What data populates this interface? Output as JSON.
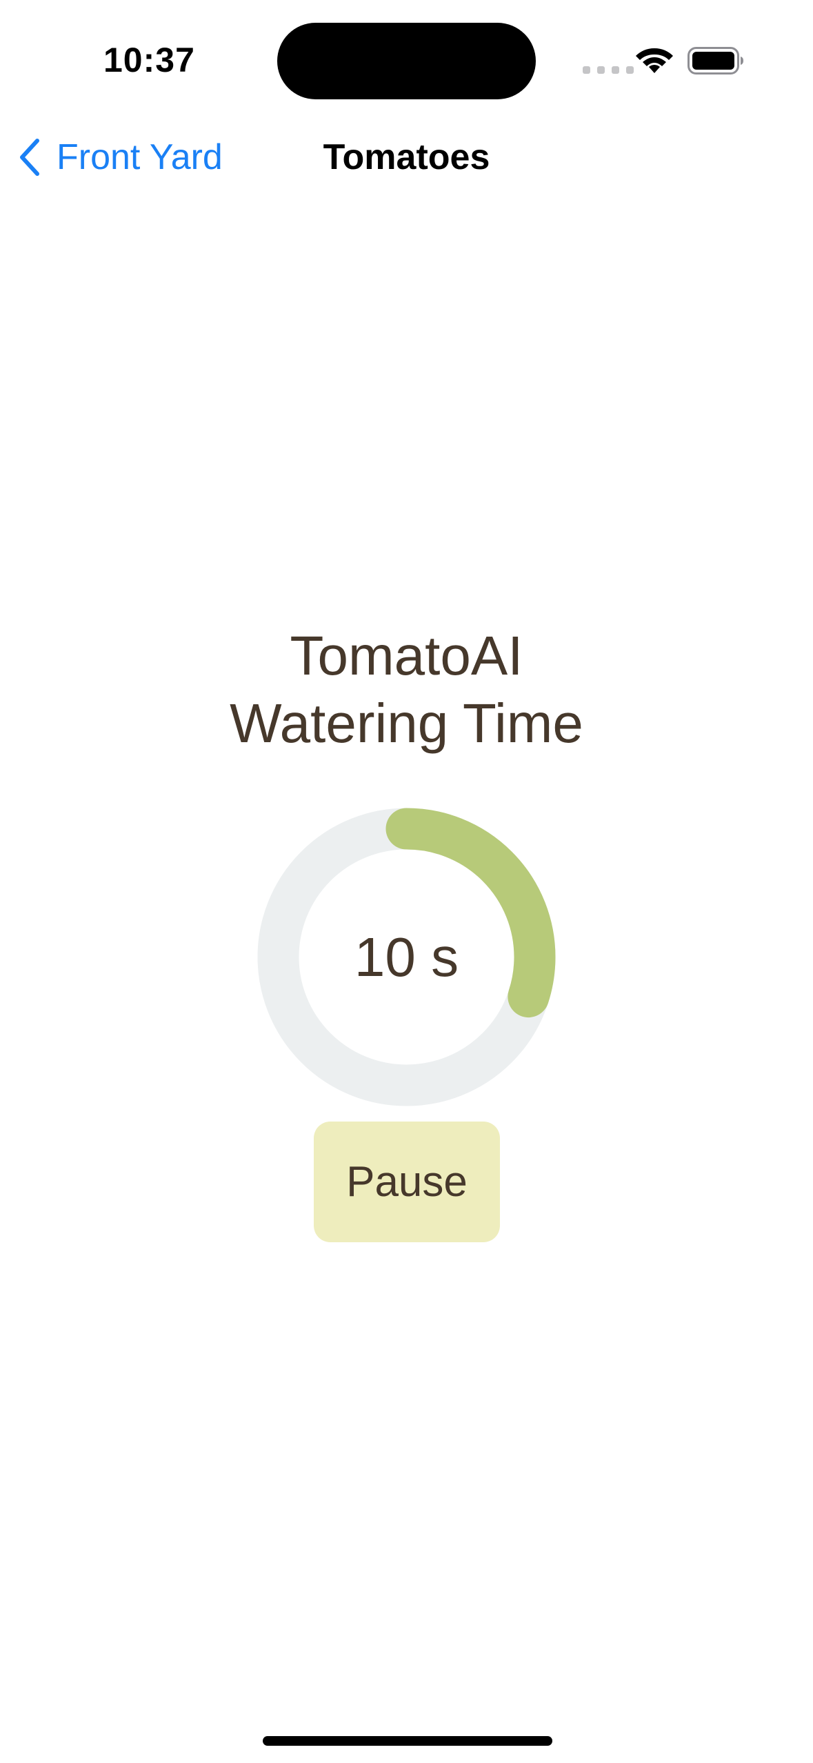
{
  "status_bar": {
    "time": "10:37",
    "icons": [
      "cellular-signal-icon",
      "wifi-icon",
      "battery-icon"
    ]
  },
  "nav": {
    "back_label": "Front Yard",
    "title": "Tomatoes"
  },
  "main": {
    "title_line1": "TomatoAI",
    "title_line2": "Watering Time",
    "timer_value": "10 s",
    "timer_progress": 0.3,
    "pause_label": "Pause"
  },
  "colors": {
    "accent_blue": "#1a80f5",
    "text_brown": "#46382b",
    "ring_track": "#eceff0",
    "ring_progress": "#b7ca79",
    "button_bg": "#eeedbd"
  }
}
